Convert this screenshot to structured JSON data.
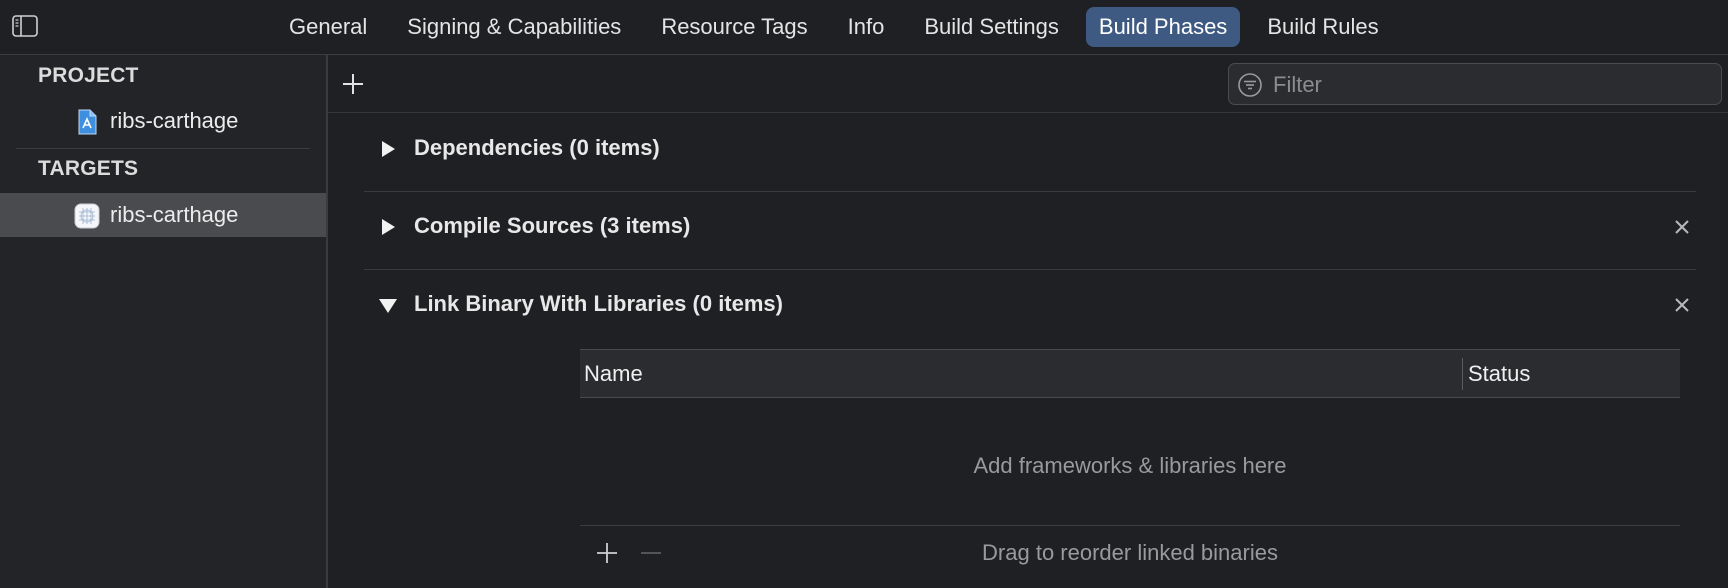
{
  "tabs": [
    {
      "label": "General",
      "active": false
    },
    {
      "label": "Signing & Capabilities",
      "active": false
    },
    {
      "label": "Resource Tags",
      "active": false
    },
    {
      "label": "Info",
      "active": false
    },
    {
      "label": "Build Settings",
      "active": false
    },
    {
      "label": "Build Phases",
      "active": true
    },
    {
      "label": "Build Rules",
      "active": false
    }
  ],
  "sidebar": {
    "project_header": "PROJECT",
    "project_item": "ribs-carthage",
    "targets_header": "TARGETS",
    "target_item": "ribs-carthage"
  },
  "toolbar": {
    "filter_placeholder": "Filter"
  },
  "phases": [
    {
      "title": "Dependencies (0 items)",
      "expanded": false,
      "removable": false
    },
    {
      "title": "Compile Sources (3 items)",
      "expanded": false,
      "removable": true
    },
    {
      "title": "Link Binary With Libraries (0 items)",
      "expanded": true,
      "removable": true
    }
  ],
  "libraries": {
    "col_name": "Name",
    "col_status": "Status",
    "empty_text": "Add frameworks & libraries here",
    "footer_hint": "Drag to reorder linked binaries"
  },
  "colors": {
    "background": "#1f2024",
    "sidebar_bg": "#232427",
    "active_tab": "#3e5a82",
    "selected_row": "#4a4b4f"
  },
  "icons": [
    "sidebar-toggle-icon",
    "project-file-icon",
    "target-app-icon",
    "plus-icon",
    "filter-icon",
    "disclosure-triangle-icon",
    "close-icon",
    "minus-icon"
  ]
}
